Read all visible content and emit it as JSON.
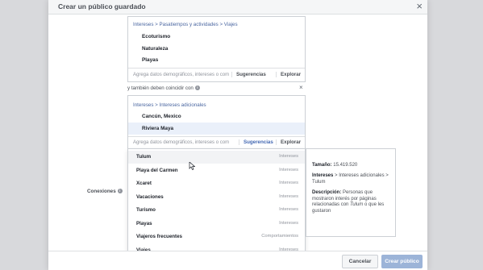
{
  "modal": {
    "title": "Crear un público guardado",
    "close": "×"
  },
  "box1": {
    "breadcrumb": "Intereses > Pasatiempos y actividades > Viajes",
    "items": [
      "Ecoturismo",
      "Naturaleza",
      "Playas"
    ],
    "input_placeholder": "Agrega datos demográficos, intereses o com",
    "suggestions_label": "Sugerencias",
    "explore_label": "Explorar"
  },
  "narrow": {
    "label": "y también deben coincidir con",
    "close": "×"
  },
  "box2": {
    "breadcrumb": "Intereses > Intereses adicionales",
    "items": [
      "Cancún, Mexico",
      "Riviera Maya"
    ],
    "input_placeholder": "Agrega datos demográficos, intereses o com",
    "suggestions_label": "Sugerencias",
    "explore_label": "Explorar"
  },
  "dropdown": {
    "rows": [
      {
        "name": "Tulum",
        "type": "Intereses"
      },
      {
        "name": "Playa del Carmen",
        "type": "Intereses"
      },
      {
        "name": "Xcaret",
        "type": "Intereses"
      },
      {
        "name": "Vacaciones",
        "type": "Intereses"
      },
      {
        "name": "Turismo",
        "type": "Intereses"
      },
      {
        "name": "Playas",
        "type": "Intereses"
      },
      {
        "name": "Viajeros frecuentes",
        "type": "Comportamientos"
      },
      {
        "name": "Viajes",
        "type": "Intereses"
      }
    ]
  },
  "detail": {
    "size_label": "Tamaño:",
    "size_value": "15.419.520",
    "interests_label": "Intereses",
    "interests_path": "> Intereses adicionales > Tulum",
    "desc_label": "Descripción:",
    "desc_before": "Personas que mostraron interés por páginas relacionadas con",
    "desc_em": "Tulum",
    "desc_after": "o que les gustaron"
  },
  "connections": {
    "label": "Conexiones"
  },
  "footer": {
    "cancel_label": "Cancelar",
    "create_label": "Crear público"
  },
  "colors": {
    "accent": "#4267b2",
    "breadcrumb": "#4b67a1",
    "disabled_button": "#9cb4d8",
    "highlight": "#eaf0fa"
  }
}
